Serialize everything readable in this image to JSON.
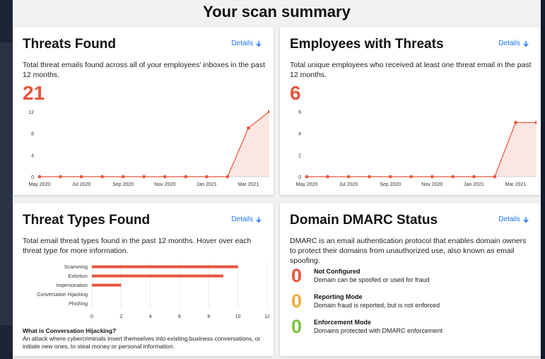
{
  "page": {
    "title": "Your scan summary"
  },
  "cards": {
    "threats_found": {
      "title": "Threats Found",
      "details_label": "Details",
      "description": "Total threat emails found across all of your employees' inboxes in the past 12 months.",
      "count": "21"
    },
    "employees_with_threats": {
      "title": "Employees with Threats",
      "details_label": "Details",
      "description": "Total unique employees who received at least one threat email in the past 12 months.",
      "count": "6"
    },
    "threat_types": {
      "title": "Threat Types Found",
      "details_label": "Details",
      "description": "Total email threat types found in the past 12 months. Hover over each threat type for more information.",
      "hijack_question": "What is Conversation Hijacking?",
      "hijack_answer": "An attack where cybercriminals insert themselves into existing business conversations, or initiate new ones, to steal money or personal information."
    },
    "dmarc": {
      "title": "Domain DMARC Status",
      "details_label": "Details",
      "description": "DMARC is an email authentication protocol that enables domain owners to protect their domains from unauthorized use, also known as email spoofing.",
      "rows": [
        {
          "count": "0",
          "label": "Not Configured",
          "sub": "Domain can be spoofed or used for fraud",
          "color": "#e8543b"
        },
        {
          "count": "0",
          "label": "Reporting Mode",
          "sub": "Domain fraud is reported, but is not enforced",
          "color": "#f2a93b"
        },
        {
          "count": "0",
          "label": "Enforcement Mode",
          "sub": "Domains protected with DMARC enforcement",
          "color": "#7cc243"
        }
      ]
    }
  },
  "icons": {
    "details": "arrow-down-icon"
  },
  "colors": {
    "accent": "#e8543b",
    "link": "#1a73e8"
  },
  "chart_data": [
    {
      "type": "area",
      "x": [
        "2020-05",
        "2020-06",
        "2020-07",
        "2020-08",
        "2020-09",
        "2020-10",
        "2020-11",
        "2020-12",
        "2021-01",
        "2021-02",
        "2021-03",
        "2021-04"
      ],
      "xticks": [
        "May 2020",
        "Jul 2020",
        "Sep 2020",
        "Nov 2020",
        "Jan 2021",
        "Mar 2021"
      ],
      "values": [
        0,
        0,
        0,
        0,
        0,
        0,
        0,
        0,
        0,
        0,
        9,
        12
      ],
      "ylim": [
        0,
        12
      ],
      "yticks": [
        "0",
        "4",
        "8",
        "12"
      ],
      "color": "#e8543b"
    },
    {
      "type": "area",
      "x": [
        "2020-05",
        "2020-06",
        "2020-07",
        "2020-08",
        "2020-09",
        "2020-10",
        "2020-11",
        "2020-12",
        "2021-01",
        "2021-02",
        "2021-03",
        "2021-04"
      ],
      "xticks": [
        "May 2020",
        "Jul 2020",
        "Sep 2020",
        "Nov 2020",
        "Jan 2021",
        "Mar 2021"
      ],
      "values": [
        0,
        0,
        0,
        0,
        0,
        0,
        0,
        0,
        0,
        0,
        5,
        5
      ],
      "ylim": [
        0,
        6
      ],
      "yticks": [
        "0",
        "2",
        "4",
        "6"
      ],
      "color": "#e8543b"
    },
    {
      "type": "bar",
      "orientation": "horizontal",
      "categories": [
        "Scamming",
        "Extortion",
        "Impersonation",
        "Conversation Hijacking",
        "Phishing"
      ],
      "values": [
        10,
        9,
        2,
        0,
        0
      ],
      "xlim": [
        0,
        12
      ],
      "xticks": [
        "0",
        "2",
        "4",
        "6",
        "8",
        "10",
        "12"
      ],
      "color": "#e8543b"
    }
  ]
}
